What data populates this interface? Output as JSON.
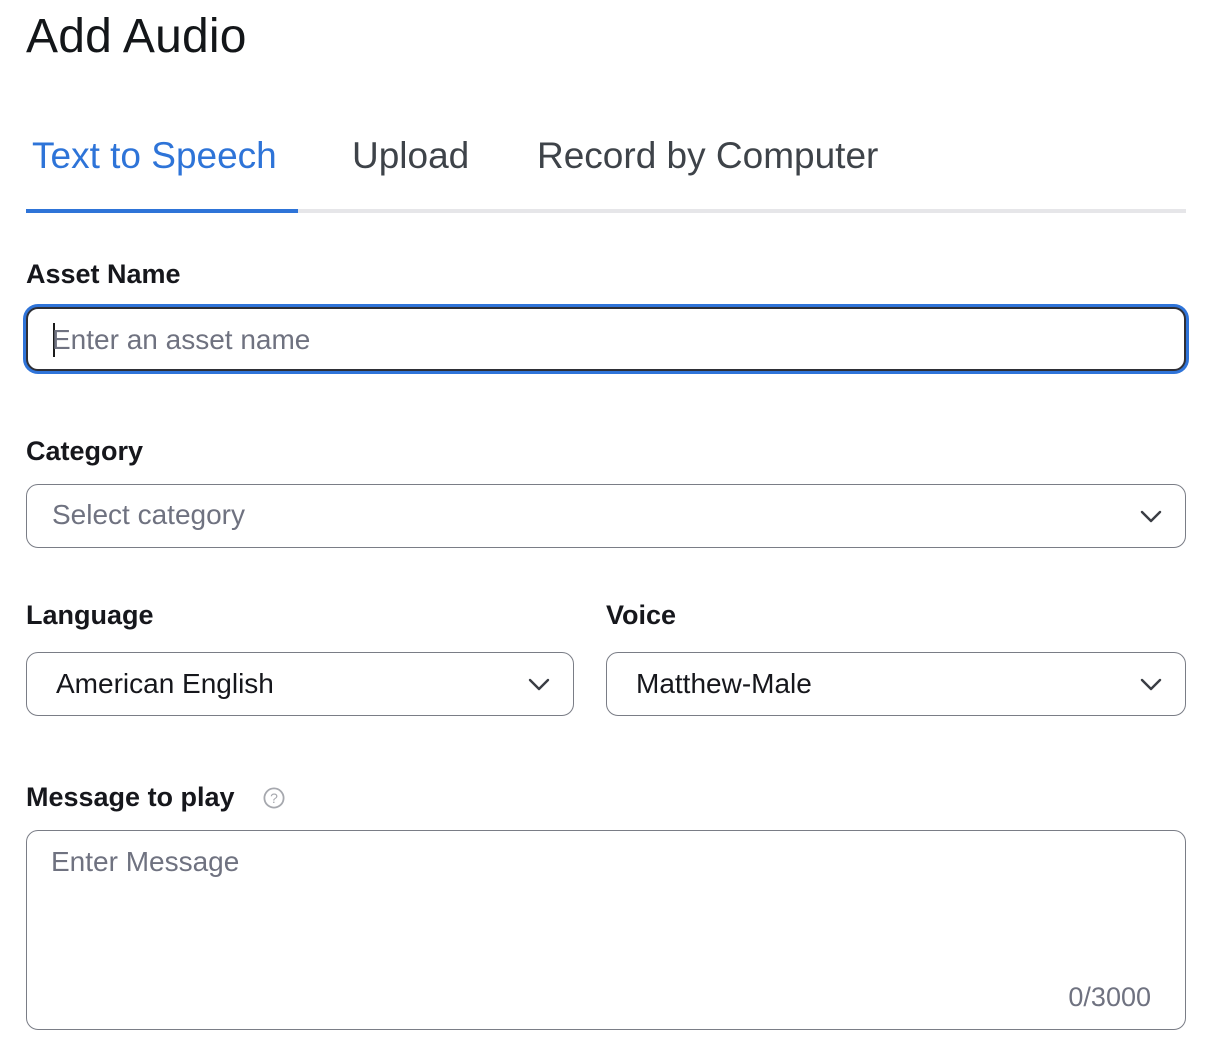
{
  "page": {
    "title": "Add Audio"
  },
  "tabs": [
    {
      "label": "Text to Speech",
      "active": true
    },
    {
      "label": "Upload",
      "active": false
    },
    {
      "label": "Record by Computer",
      "active": false
    }
  ],
  "form": {
    "asset_name": {
      "label": "Asset Name",
      "placeholder": "Enter an asset name",
      "value": ""
    },
    "category": {
      "label": "Category",
      "placeholder": "Select category"
    },
    "language": {
      "label": "Language",
      "value": "American English"
    },
    "voice": {
      "label": "Voice",
      "value": "Matthew-Male"
    },
    "message": {
      "label": "Message to play",
      "placeholder": "Enter Message",
      "counter": "0/3000"
    }
  },
  "icons": {
    "chevron": "chevron-down-icon",
    "help": "question-circle-icon"
  },
  "colors": {
    "accent": "#2e74d8",
    "focus_ring": "#2f74d9",
    "text_primary": "#16171c",
    "placeholder": "#6f7280",
    "border": "#7a7d86"
  }
}
